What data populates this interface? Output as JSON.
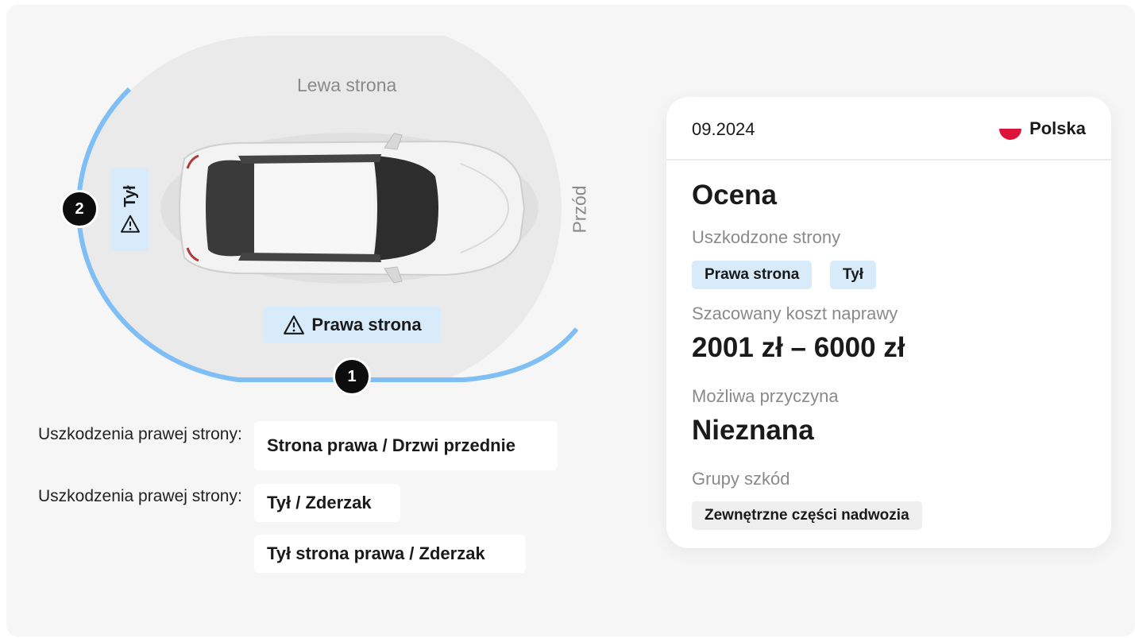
{
  "diagram": {
    "left_side_label": "Lewa strona",
    "front_label": "Przód",
    "right_side_chip": "Prawa strona",
    "rear_chip": "Tył",
    "markers": [
      "1",
      "2"
    ]
  },
  "damages": {
    "groups": [
      {
        "label": "Uszkodzenia prawej strony:",
        "items": [
          "Strona prawa / Drzwi przednie"
        ]
      },
      {
        "label": "Uszkodzenia prawej strony:",
        "items": [
          "Tył / Zderzak",
          "Tył strona prawa / Zderzak"
        ]
      }
    ]
  },
  "card": {
    "date": "09.2024",
    "country": "Polska",
    "title": "Ocena",
    "damaged_sides_label": "Uszkodzone strony",
    "damaged_sides": [
      "Prawa strona",
      "Tył"
    ],
    "cost_label": "Szacowany koszt naprawy",
    "cost_value": "2001 zł – 6000 zł",
    "cause_label": "Możliwa przyczyna",
    "cause_value": "Nieznana",
    "groups_label": "Grupy szkód",
    "groups": [
      "Zewnętrzne części nadwozia"
    ]
  },
  "colors": {
    "accent_blue": "#7fbff5",
    "chip_blue": "#d7ebfb",
    "flag_red": "#dc143c"
  }
}
